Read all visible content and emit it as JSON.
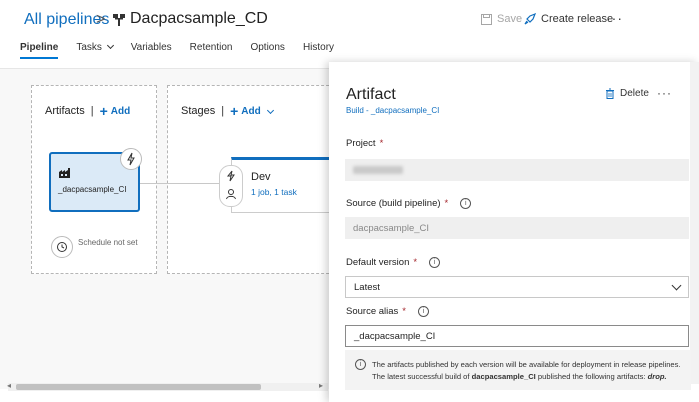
{
  "header": {
    "breadcrumb_link": "All pipelines",
    "breadcrumb_sep": ">",
    "pipeline_name": "Dacpacsample_CD",
    "save_label": "Save",
    "create_release_label": "Create release",
    "more_label": "···"
  },
  "tabs": [
    {
      "label": "Pipeline",
      "active": true
    },
    {
      "label": "Tasks",
      "active": false
    },
    {
      "label": "Variables",
      "active": false
    },
    {
      "label": "Retention",
      "active": false
    },
    {
      "label": "Options",
      "active": false
    },
    {
      "label": "History",
      "active": false
    }
  ],
  "artifacts_section": {
    "title": "Artifacts",
    "add_label": "Add",
    "artifact_label": "_dacpacsample_CI",
    "schedule_label": "Schedule not set"
  },
  "stages_section": {
    "title": "Stages",
    "add_label": "Add",
    "stage_name": "Dev",
    "stage_sub": "1 job, 1 task"
  },
  "panel": {
    "title": "Artifact",
    "subtitle": "Build - _dacpacsample_CI",
    "delete_label": "Delete",
    "more_label": "···",
    "project_label": "Project",
    "source_label": "Source (build pipeline)",
    "source_value": "dacpacsample_CI",
    "default_version_label": "Default version",
    "default_version_value": "Latest",
    "source_alias_label": "Source alias",
    "source_alias_value": "_dacpacsample_CI",
    "required_marker": "*",
    "info_line1": "The artifacts published by each version will be available for deployment in release pipelines.",
    "info_line2_pre": "The latest successful build of ",
    "info_line2_bold": "dacpacsample_CI",
    "info_line2_post": " published the following artifacts: ",
    "info_line2_art": "drop."
  },
  "colors": {
    "accent": "#106ebe",
    "selected_fill": "#dbeaf7",
    "required": "#a4262c"
  }
}
